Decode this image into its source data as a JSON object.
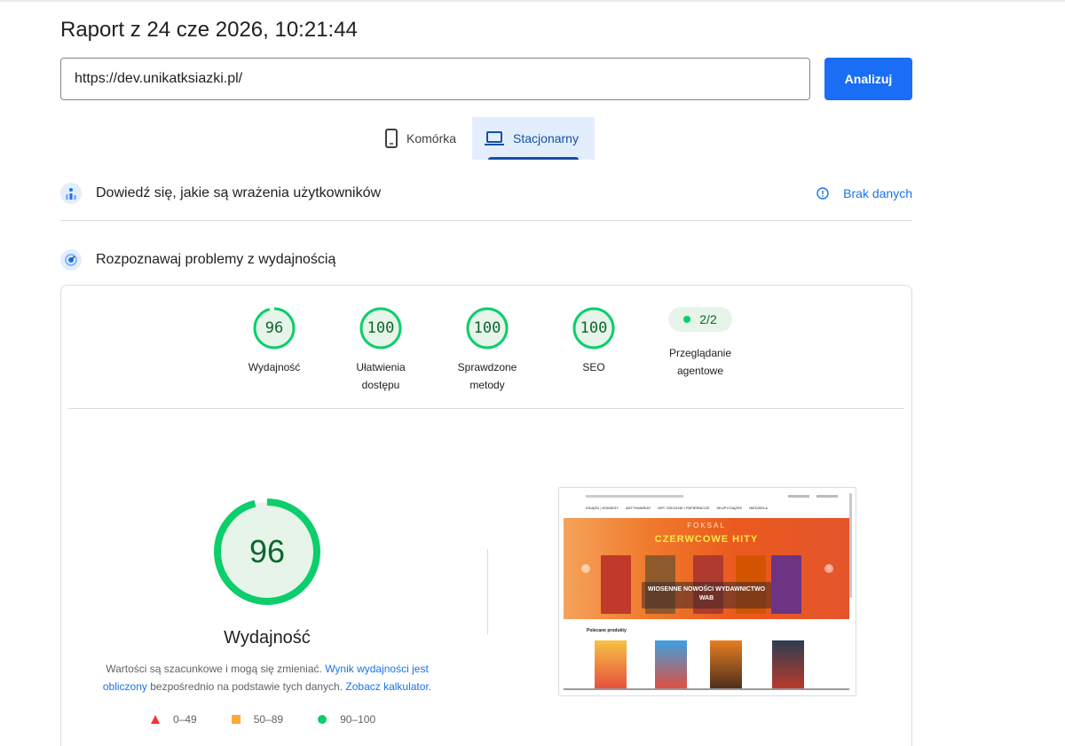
{
  "report": {
    "title": "Raport z 24 cze 2026, 10:21:44"
  },
  "search": {
    "url": "https://dev.unikatksiazki.pl/",
    "analyze_label": "Analizuj"
  },
  "tabs": [
    {
      "label": "Komórka",
      "icon": "mobile-phone-icon",
      "active": false
    },
    {
      "label": "Stacjonarny",
      "icon": "laptop-icon",
      "active": true
    }
  ],
  "field_data": {
    "title": "Dowiedź się, jakie są wrażenia użytkowników",
    "status": "Brak danych"
  },
  "lab_data": {
    "title": "Rozpoznawaj problemy z wydajnością"
  },
  "categories": [
    {
      "score": "96",
      "value": 96,
      "label": "Wydajność"
    },
    {
      "score": "100",
      "value": 100,
      "label": "Ułatwienia dostępu"
    },
    {
      "score": "100",
      "value": 100,
      "label": "Sprawdzone metody"
    },
    {
      "score": "100",
      "value": 100,
      "label": "SEO"
    },
    {
      "score": "2/2",
      "label": "Przeglądanie agentowe"
    }
  ],
  "performance": {
    "score": "96",
    "value": 96,
    "label": "Wydajność",
    "note_prefix": "Wartości są szacunkowe i mogą się zmieniać. ",
    "note_link1": "Wynik wydajności jest obliczony",
    "note_middle": " bezpośrednio na podstawie tych danych. ",
    "note_link2": "Zobacz kalkulator",
    "note_suffix": "."
  },
  "legend": [
    {
      "range": "0–49",
      "color": "#ff3333",
      "shape": "triangle"
    },
    {
      "range": "50–89",
      "color": "#ffaa33",
      "shape": "square"
    },
    {
      "range": "90–100",
      "color": "#0cce6b",
      "shape": "circle"
    }
  ],
  "screenshot": {
    "brand": "FOKSAL",
    "headline": "CZERWCOWE HITY",
    "overlay": "WIOSENNE NOWOŚCI WYDAWNICTWO WAB",
    "recommended": "Polecane produkty",
    "nav": [
      "KSIĄŻKI | KOMIKSY",
      "ANTYKWARIAT",
      "ART. SZKOLNE I PAPIERNICZE",
      "SKUP KSIĄŻEK",
      "NIEDZIELA"
    ]
  },
  "colors": {
    "accent": "#1a73e8",
    "pass": "#0cce6b",
    "pass_text": "#0d652d"
  }
}
